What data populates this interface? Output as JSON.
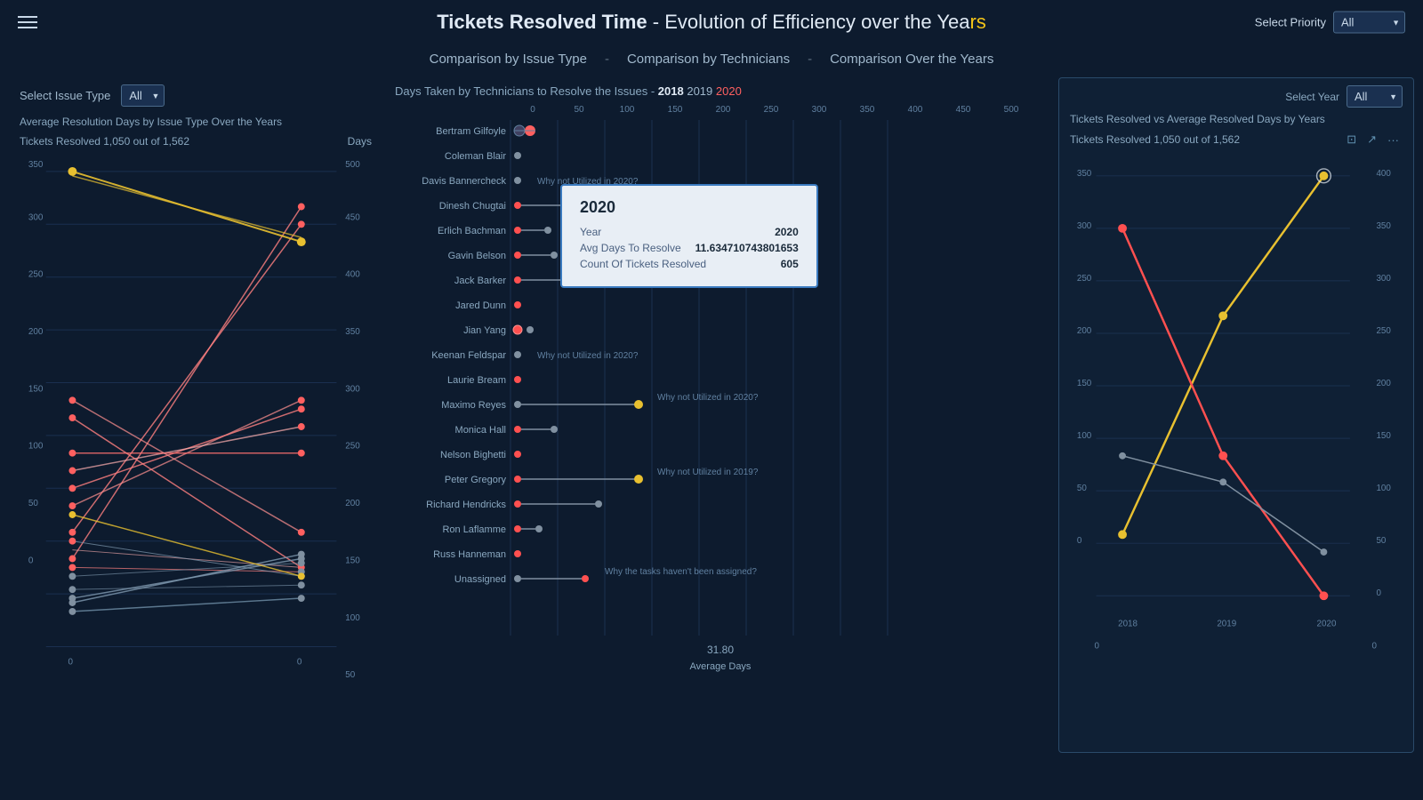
{
  "header": {
    "title_part1": "Tickets Resolved Time",
    "title_part2": " - Evolution of Efficiency over the Yea",
    "title_highlight": "rs",
    "hamburger_label": "menu",
    "priority_label": "Select Priority",
    "priority_value": "All"
  },
  "nav": {
    "item1": "Comparison by Issue Type",
    "separator1": "-",
    "item2": "Comparison by Technicians",
    "separator2": "-",
    "item3": "Comparison Over the Years"
  },
  "left_panel": {
    "select_label": "Select Issue Type",
    "select_value": "All",
    "chart_subtitle": "Average Resolution Days by Issue Type Over the Years",
    "stats_left": "Tickets Resolved 1,050 out of 1,562",
    "stats_right": "Days"
  },
  "mid_panel": {
    "header": "Days Taken by Technicians to Resolve the Issues  - ",
    "year2018": "2018",
    "year2019": "2019",
    "year2020": "2020",
    "avg_days_value": "31.80",
    "avg_days_label": "Average Days",
    "axis_values": [
      "0",
      "50",
      "100",
      "150",
      "200",
      "250",
      "300",
      "350",
      "400",
      "450",
      "500"
    ],
    "technicians": [
      {
        "name": "Bertram Gilfoyle",
        "type": "toggle",
        "note": ""
      },
      {
        "name": "Coleman Blair",
        "type": "gray_dot",
        "note": ""
      },
      {
        "name": "Davis Bannercheck",
        "type": "gray_dot",
        "note": "Why not Utilized in 2020?"
      },
      {
        "name": "Dinesh Chugtai",
        "type": "red_dot_line",
        "note": ""
      },
      {
        "name": "Erlich Bachman",
        "type": "red_gray_line",
        "note": ""
      },
      {
        "name": "Gavin Belson",
        "type": "red_gray_line",
        "note": ""
      },
      {
        "name": "Jack Barker",
        "type": "gray_long",
        "note": ""
      },
      {
        "name": "Jared Dunn",
        "type": "red_only",
        "note": ""
      },
      {
        "name": "Jian Yang",
        "type": "toggle2",
        "note": ""
      },
      {
        "name": "Keenan Feldspar",
        "type": "gray_dot",
        "note": "Why not Utilized in 2020?"
      },
      {
        "name": "Laurie Bream",
        "type": "red_only",
        "note": ""
      },
      {
        "name": "Maximo Reyes",
        "type": "gray_yellow_line",
        "note": "Why not Utilized in 2020?"
      },
      {
        "name": "Monica Hall",
        "type": "red_gray_line",
        "note": ""
      },
      {
        "name": "Nelson Bighetti",
        "type": "red_only",
        "note": ""
      },
      {
        "name": "Peter Gregory",
        "type": "red_yellow_line",
        "note": "Why not Utilized in 2019?"
      },
      {
        "name": "Richard Hendricks",
        "type": "red_gray_line2",
        "note": ""
      },
      {
        "name": "Ron Laflamme",
        "type": "red_gray_close",
        "note": ""
      },
      {
        "name": "Russ Hanneman",
        "type": "red_only",
        "note": ""
      },
      {
        "name": "Unassigned",
        "type": "gray_red_line",
        "note": "Why the tasks haven't been assigned?"
      }
    ]
  },
  "tooltip": {
    "year": "2020",
    "fields": [
      {
        "label": "Year",
        "value": "2020"
      },
      {
        "label": "Avg Days To Resolve",
        "value": "11.634710743801653"
      },
      {
        "label": "Count Of Tickets Resolved",
        "value": "605"
      }
    ]
  },
  "right_panel": {
    "year_select_label": "Select Year",
    "year_select_value": "All",
    "title": "Tickets Resolved vs Average Resolved Days by Years",
    "stats": "Tickets Resolved 1,050 out of 1,562",
    "icons": [
      "filter",
      "export",
      "more"
    ]
  }
}
